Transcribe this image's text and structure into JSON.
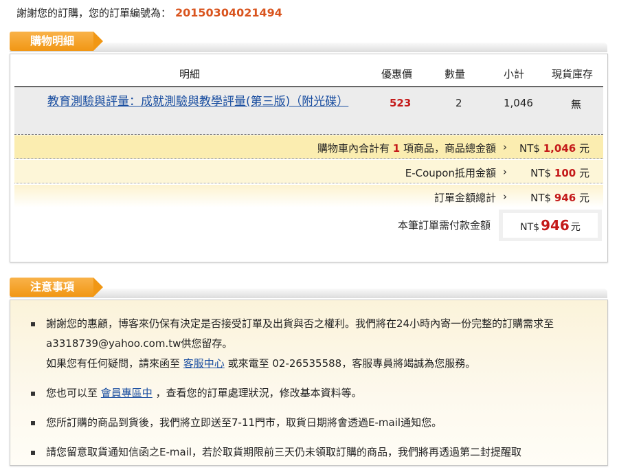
{
  "order": {
    "prefix": "謝謝您的訂購，您的訂單編號為：",
    "number": "20150304021494"
  },
  "cart": {
    "section_title": "購物明細",
    "headers": {
      "detail": "明細",
      "price": "優惠價",
      "qty": "數量",
      "subtotal": "小計",
      "stock": "現貨庫存"
    },
    "item": {
      "name": "教育測驗與評量：成就測驗與教學評量(第三版)（附光碟）",
      "price": "523",
      "qty": "2",
      "subtotal": "1,046",
      "stock": "無"
    },
    "summary": {
      "total_prefix": "購物車內合計有",
      "total_count": "1",
      "total_suffix": "項商品，商品總金額",
      "total_currency": "NT$",
      "total_amount": "1,046",
      "total_unit": "元",
      "coupon_label": "E-Coupon抵用金額",
      "coupon_currency": "NT$",
      "coupon_amount": "100",
      "coupon_unit": "元",
      "order_label": "訂單金額總計",
      "order_currency": "NT$",
      "order_amount": "946",
      "order_unit": "元",
      "pay_label": "本筆訂單需付款金額",
      "pay_currency": "NT$",
      "pay_amount": "946",
      "pay_unit": "元",
      "arrow": "›"
    }
  },
  "notes": {
    "section_title": "注意事項",
    "item1_text": "謝謝您的惠顧，博客來仍保有決定是否接受訂單及出貨與否之權利。我們將在24小時內寄一份完整的訂購需求至a3318739@yahoo.com.tw供您留存。",
    "item1_line2_a": "如果您有任何疑問，請來函至",
    "item1_link": "客服中心",
    "item1_line2_b": "或來電至 02-26535588，客服專員將竭誠為您服務。",
    "item2_a": "您也可以至",
    "item2_link": "會員專區中",
    "item2_b": "，查看您的訂單處理狀況，修改基本資料等。",
    "item3": "您所訂購的商品到貨後，我們將立即送至7-11門市，取貨日期將會透過E-mail通知您。",
    "item4": "請您留意取貨通知信函之E-mail，若於取貨期限前三天仍未領取訂購的商品，我們將再透過第二封提醒取"
  },
  "colors": {
    "accent": "#f19714",
    "order_number": "#d9541e",
    "price_red": "#c41a1a",
    "link": "#1a4ea0"
  }
}
